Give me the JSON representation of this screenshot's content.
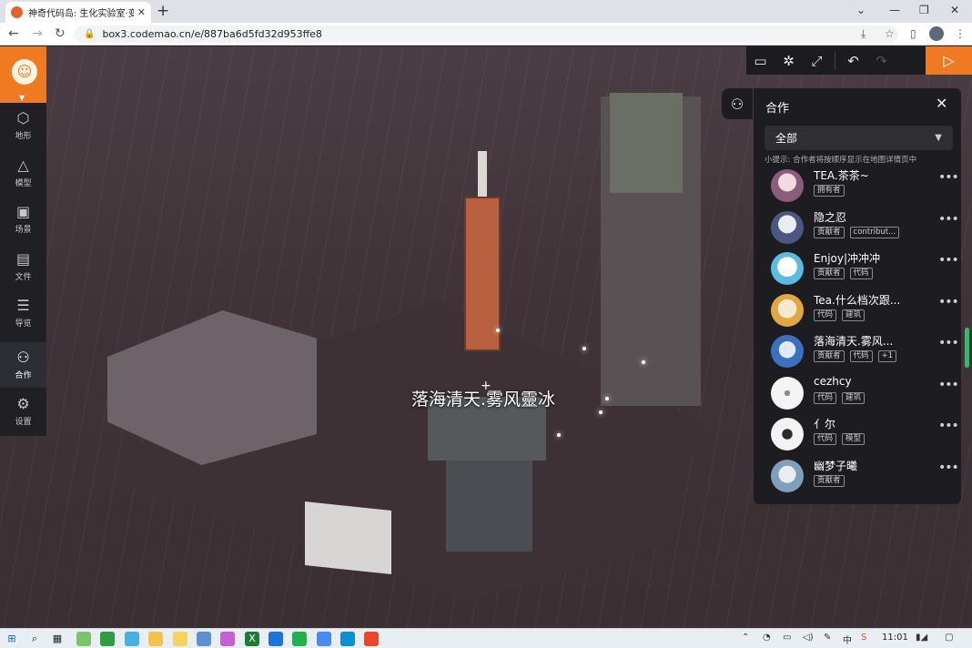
{
  "browser": {
    "tab_title": "神奇代码岛: 生化实验室·变放",
    "tab_close": "✕",
    "new_tab": "+",
    "url": "box3.codemao.cn/e/887ba6d5fd32d953ffe8"
  },
  "scene": {
    "player_label": "落海清天.雾风靈冰"
  },
  "sidebar": {
    "items": [
      {
        "label": "地形",
        "icon": "cube-icon"
      },
      {
        "label": "模型",
        "icon": "bell-icon"
      },
      {
        "label": "场景",
        "icon": "image-icon"
      },
      {
        "label": "文件",
        "icon": "folder-icon"
      },
      {
        "label": "导览",
        "icon": "list-icon"
      },
      {
        "label": "合作",
        "icon": "people-icon"
      },
      {
        "label": "设置",
        "icon": "gear-icon"
      }
    ],
    "active": "合作"
  },
  "toolbar": {
    "accent": "#f07a22"
  },
  "collab": {
    "title": "合作",
    "filter_value": "全部",
    "hint": "小提示: 合作者将按顺序显示在地图详情页中",
    "members": [
      {
        "name": "TEA.茶茶~",
        "tags": [
          "拥有者"
        ]
      },
      {
        "name": "隐之忍",
        "tags": [
          "贡献者",
          "contribut..."
        ]
      },
      {
        "name": "Enjoy|冲冲冲",
        "tags": [
          "贡献者",
          "代码"
        ]
      },
      {
        "name": "Tea.什么档次跟...",
        "tags": [
          "代码",
          "建筑"
        ]
      },
      {
        "name": "落海清天.雾风...",
        "tags": [
          "贡献者",
          "代码",
          "+1"
        ]
      },
      {
        "name": "cezhcy",
        "tags": [
          "代码",
          "建筑"
        ]
      },
      {
        "name": "亻尔",
        "tags": [
          "代码",
          "模型"
        ]
      },
      {
        "name": "幽梦子曦",
        "tags": [
          "贡献者"
        ]
      }
    ],
    "more_label": "•••"
  },
  "taskbar": {
    "time": "11:01"
  }
}
